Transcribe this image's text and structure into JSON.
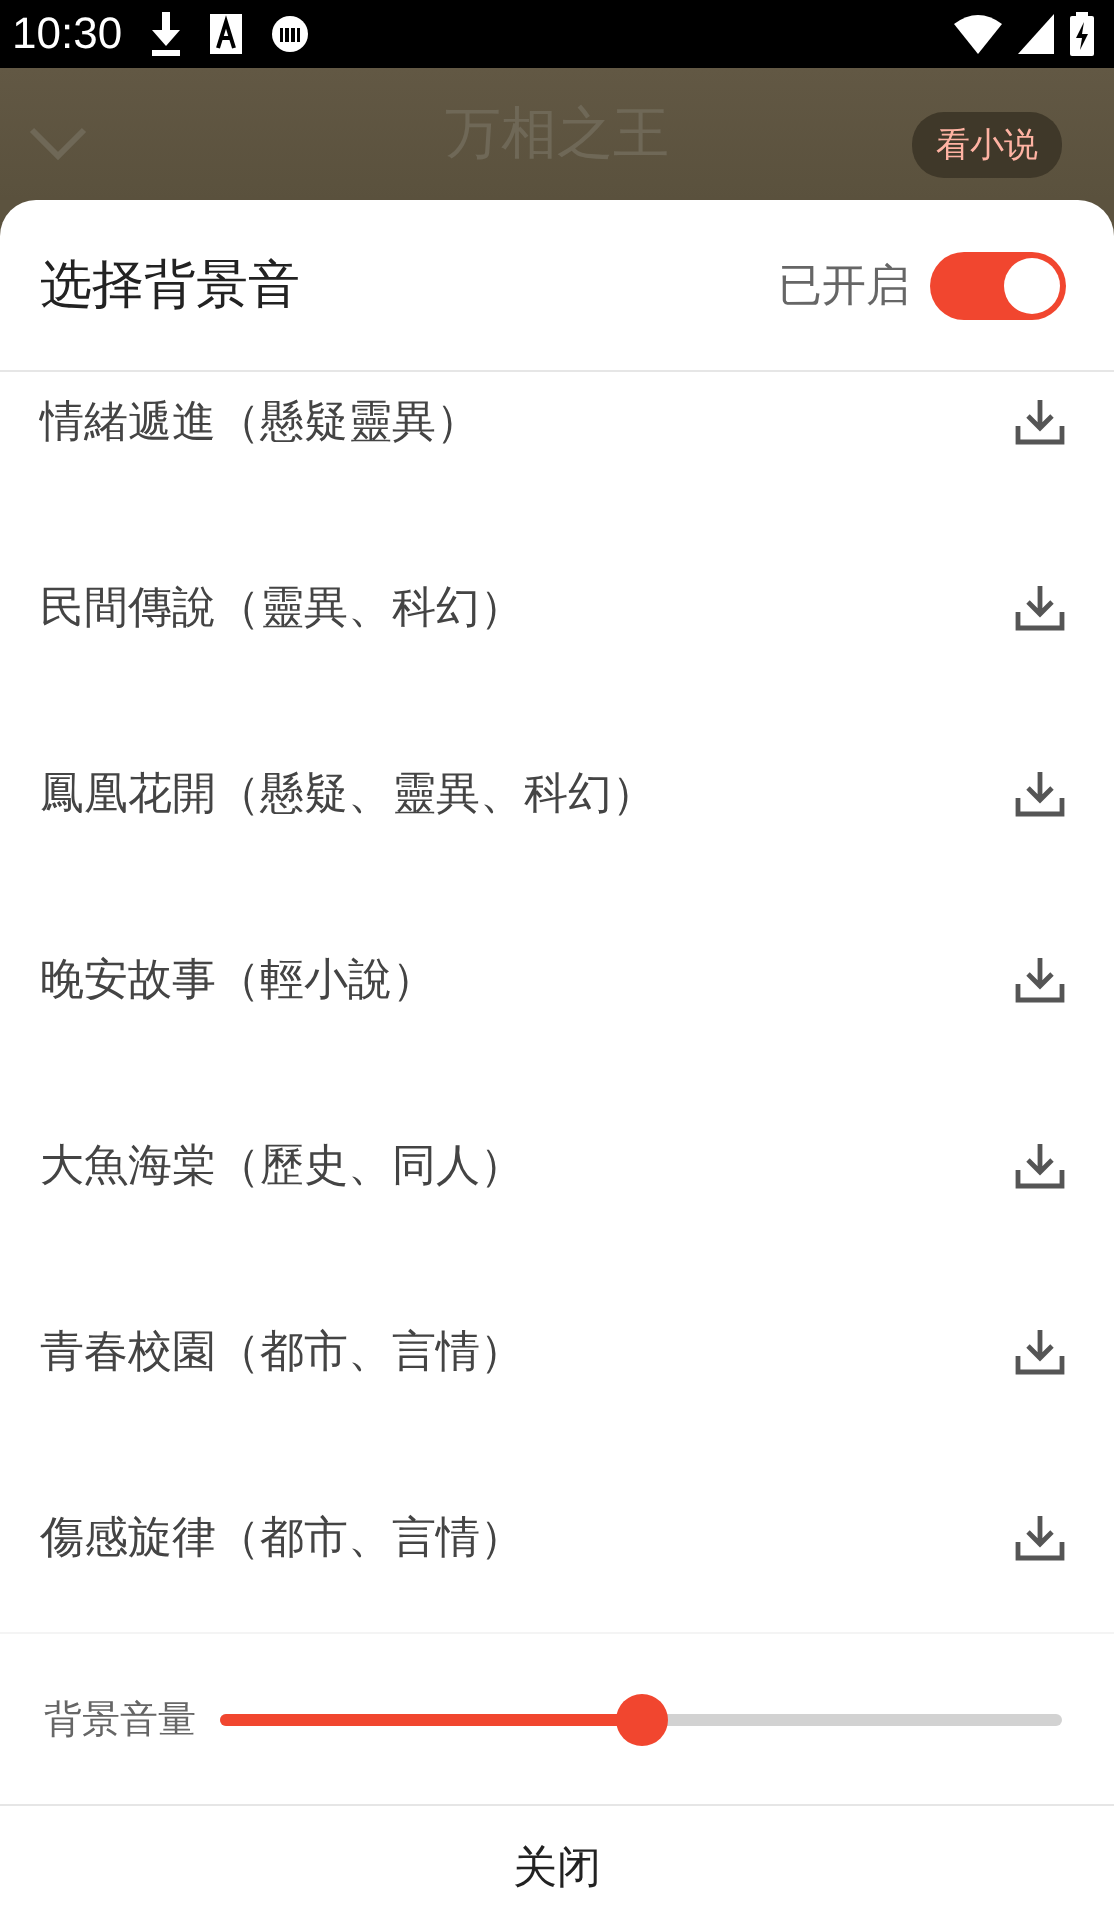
{
  "status_bar": {
    "time": "10:30"
  },
  "header": {
    "title": "万相之王",
    "action": "看小说"
  },
  "sheet": {
    "title": "选择背景音",
    "toggle": {
      "label": "已开启",
      "on": true
    },
    "tracks": [
      {
        "name": "情緒遞進（懸疑靈異）"
      },
      {
        "name": "民間傳說（靈異、科幻）"
      },
      {
        "name": "鳳凰花開（懸疑、靈異、科幻）"
      },
      {
        "name": "晚安故事（輕小說）"
      },
      {
        "name": "大魚海棠（歷史、同人）"
      },
      {
        "name": "青春校園（都市、言情）"
      },
      {
        "name": "傷感旋律（都市、言情）"
      }
    ],
    "volume": {
      "label": "背景音量",
      "level": 0.5
    },
    "close": "关闭"
  }
}
